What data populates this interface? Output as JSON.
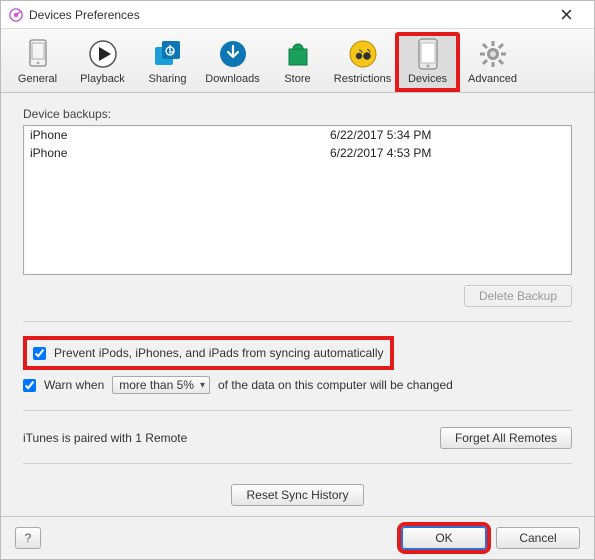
{
  "window": {
    "title": "Devices Preferences"
  },
  "tabs": {
    "general": {
      "label": "General"
    },
    "playback": {
      "label": "Playback"
    },
    "sharing": {
      "label": "Sharing"
    },
    "downloads": {
      "label": "Downloads"
    },
    "store": {
      "label": "Store"
    },
    "restrictions": {
      "label": "Restrictions"
    },
    "devices": {
      "label": "Devices"
    },
    "advanced": {
      "label": "Advanced"
    }
  },
  "backups": {
    "label": "Device backups:",
    "rows": [
      {
        "name": "iPhone",
        "date": "6/22/2017 5:34 PM"
      },
      {
        "name": "iPhone",
        "date": "6/22/2017 4:53 PM"
      }
    ],
    "deleteLabel": "Delete Backup"
  },
  "options": {
    "preventSync": "Prevent iPods, iPhones, and iPads from syncing automatically",
    "warnWhen": "Warn when",
    "warnThresholdSelected": "more than 5%",
    "warnTail": "of the data on this computer will be changed"
  },
  "remotes": {
    "status": "iTunes is paired with 1 Remote",
    "forgetLabel": "Forget All Remotes"
  },
  "resetSyncLabel": "Reset Sync History",
  "footer": {
    "help": "?",
    "ok": "OK",
    "cancel": "Cancel"
  }
}
